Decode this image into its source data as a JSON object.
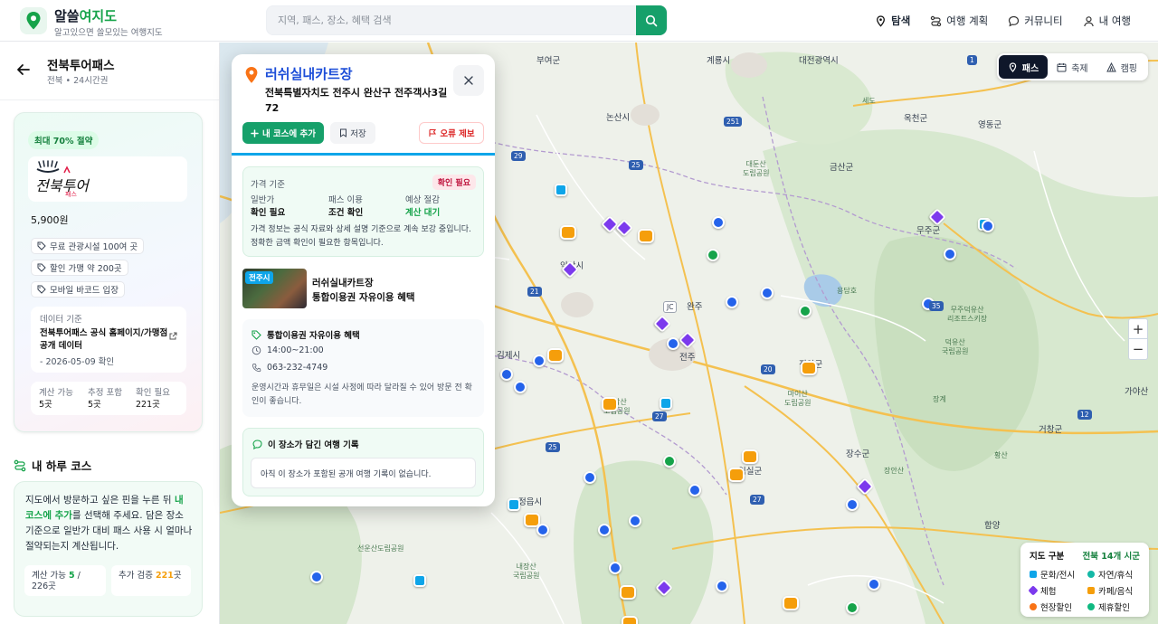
{
  "header": {
    "brand_prefix": "알쓸",
    "brand_highlight": "여지도",
    "brand_sub": "알고있으면 쓸모있는 여행지도",
    "search_placeholder": "지역, 패스, 장소, 혜택 검색",
    "nav": [
      {
        "label": "탐색",
        "icon": "map-pin-icon",
        "active": true
      },
      {
        "label": "여행 계획",
        "icon": "route-icon",
        "active": false
      },
      {
        "label": "커뮤니티",
        "icon": "chat-icon",
        "active": false
      },
      {
        "label": "내 여행",
        "icon": "user-icon",
        "active": false
      }
    ]
  },
  "sidebar": {
    "title": "전북투어패스",
    "subtitle": "전북 • 24시간권",
    "save_badge": "최대 70% 절약",
    "logo_text": "전북투어패스",
    "price": "5,900원",
    "tags": [
      "무료 관광시설 100여 곳",
      "할인 가맹 약 200곳",
      "모바일 바코드 입장"
    ],
    "data_label": "데이터 기준",
    "data_value": "전북투어패스 공식 홈페이지/가맹점 공개 데이터",
    "data_date": "- 2026-05-09 확인",
    "stats": [
      {
        "label": "계산 가능",
        "value": "5곳"
      },
      {
        "label": "추정 포함",
        "value": "5곳"
      },
      {
        "label": "확인 필요",
        "value": "221곳"
      }
    ],
    "course_title": "내 하루 코스",
    "course_text_1": "지도에서 방문하고 싶은 핀을 누른 뒤 ",
    "course_text_hl": "내 코스에 추가",
    "course_text_2": "를 선택해 주세요. 담은 장소 기준으로 일반가 대비 패스 사용 시 얼마나 절약되는지 계산됩니다.",
    "mini_calc_label": "계산 가능",
    "mini_calc_value": "5",
    "mini_calc_total": "/ 226곳",
    "mini_verify_label": "추가 검증",
    "mini_verify_value": "221",
    "mini_verify_unit": "곳"
  },
  "popup": {
    "title": "러쉬실내카트장",
    "address": "전북특별자치도 전주시 완산구 전주객사3길 72",
    "btn_add": "내 코스에 추가",
    "btn_save": "저장",
    "btn_report": "오류 제보",
    "price_title": "가격 기준",
    "price_badge": "확인 필요",
    "cols": [
      {
        "label": "일반가",
        "value": "확인 필요"
      },
      {
        "label": "패스 이용",
        "value": "조건 확인"
      },
      {
        "label": "예상 절감",
        "value": "계산 대기"
      }
    ],
    "price_note": "가격 정보는 공식 자료와 상세 설명 기준으로 계속 보강 중입니다. 정확한 금액 확인이 필요한 항목입니다.",
    "thumb_tag": "전주시",
    "place_name": "러쉬실내카트장",
    "place_benefit": "통합이용권 자유이용 혜택",
    "benefit_title": "통합이용권 자유이용 혜택",
    "hours": "14:00~21:00",
    "phone": "063-232-4749",
    "benefit_note": "운영시간과 휴무일은 시설 사정에 따라 달라질 수 있어 방문 전 확인이 좋습니다.",
    "record_title": "이 장소가 담긴 여행 기록",
    "record_empty": "아직 이 장소가 포함된 공개 여행 기록이 없습니다."
  },
  "map": {
    "layers": [
      {
        "label": "패스",
        "active": true
      },
      {
        "label": "축제",
        "active": false
      },
      {
        "label": "캠핑",
        "active": false
      }
    ],
    "zoom_in": "+",
    "zoom_out": "−",
    "legend_title": "지도 구분",
    "legend_count": "전북 14개 시군",
    "legend_items": [
      {
        "label": "문화/전시",
        "color": "#0ea5e9"
      },
      {
        "label": "자연/휴식",
        "color": "#14b8a6"
      },
      {
        "label": "체험",
        "color": "#7c3aed"
      },
      {
        "label": "카페/음식",
        "color": "#f59e0b"
      },
      {
        "label": "현장할인",
        "color": "#f97316"
      },
      {
        "label": "제휴할인",
        "color": "#10b981"
      }
    ],
    "labels": {
      "buyeo": "부여군",
      "gyeryong": "계룡시",
      "daejeon": "대전광역시",
      "nonsan": "논산시",
      "okcheon": "옥천군",
      "yeongdong": "영동군",
      "geumsan": "금산군",
      "iksan": "익산시",
      "muju": "무주군",
      "gimje": "김제시",
      "jinan": "진안군",
      "jeonju": "전주",
      "wanju": "완주",
      "geochang": "거창군",
      "jangsu": "장수군",
      "imsil": "임실군",
      "jeongeup": "정읍시",
      "hamyang": "함양",
      "maisan": "마이산\n도립공원",
      "daedunsan": "대둔산\n도립공원",
      "deogyusan": "덕유산\n국립공원",
      "moaksan": "모악산\n도립공원",
      "naejangsan": "내장산\n국립공원",
      "seonunsan": "선운산도립공원",
      "gayasan": "가야산",
      "yongdam": "용담호",
      "mujuresort": "무주덕유산\n리조트스키장",
      "janggye": "장계",
      "hwangsan": "황산",
      "jangan": "장안산",
      "sedo": "세도"
    }
  }
}
